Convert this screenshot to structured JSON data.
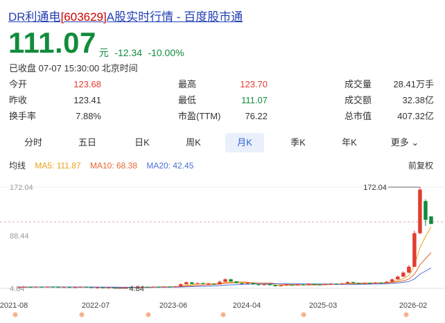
{
  "header": {
    "title_prefix": "DR利通电",
    "code": "[603629]",
    "title_suffix": "A股实时行情 - 百度股市通"
  },
  "quote": {
    "price": "111.07",
    "unit": "元",
    "change": "-12.34",
    "change_pct": "-10.00%",
    "status": "已收盘 07-07 15:30:00 北京时间"
  },
  "stats": {
    "open_label": "今开",
    "open": "123.68",
    "prev_close_label": "昨收",
    "prev_close": "123.41",
    "turnover_label": "换手率",
    "turnover": "7.88%",
    "high_label": "最高",
    "high": "123.70",
    "low_label": "最低",
    "low": "111.07",
    "pe_label": "市盈(TTM)",
    "pe": "76.22",
    "volume_label": "成交量",
    "volume": "28.41万手",
    "amount_label": "成交额",
    "amount": "32.38亿",
    "mktcap_label": "总市值",
    "mktcap": "407.32亿"
  },
  "tabs": [
    "分时",
    "五日",
    "日K",
    "周K",
    "月K",
    "季K",
    "年K",
    "更多"
  ],
  "active_tab": "月K",
  "legend": {
    "title": "均线",
    "ma5": "MA5: 111.87",
    "ma10": "MA10: 68.38",
    "ma20": "MA20: 42.45",
    "fuquan": "前复权"
  },
  "colors": {
    "up": "#e33b30",
    "down": "#118c3c",
    "ma5": "#e8a21b",
    "ma10": "#e8652f",
    "ma20": "#4a6fd8",
    "accent": "#2a5fd6"
  },
  "chart_data": {
    "type": "candlestick",
    "y_ticks": [
      "172.04",
      "88.44",
      "4.84"
    ],
    "ylim": [
      4.84,
      172.04
    ],
    "x_ticks": [
      "2021-08",
      "2022-07",
      "2023-06",
      "2024-04",
      "2025-03",
      "2026-02"
    ],
    "high_marker": "172.04",
    "low_marker": "4.84",
    "candles": [
      {
        "o": 6.6,
        "c": 6.9,
        "h": 7.2,
        "l": 6.3
      },
      {
        "o": 6.9,
        "c": 7.3,
        "h": 7.7,
        "l": 6.7
      },
      {
        "o": 7.3,
        "c": 6.9,
        "h": 7.5,
        "l": 6.6
      },
      {
        "o": 6.9,
        "c": 7.4,
        "h": 7.8,
        "l": 6.7
      },
      {
        "o": 7.4,
        "c": 7.1,
        "h": 7.7,
        "l": 6.9
      },
      {
        "o": 7.1,
        "c": 7.5,
        "h": 7.9,
        "l": 6.9
      },
      {
        "o": 7.5,
        "c": 7.2,
        "h": 7.8,
        "l": 7.0
      },
      {
        "o": 7.2,
        "c": 6.8,
        "h": 7.4,
        "l": 6.5
      },
      {
        "o": 6.8,
        "c": 7.1,
        "h": 7.4,
        "l": 6.6
      },
      {
        "o": 7.1,
        "c": 6.7,
        "h": 7.3,
        "l": 6.4
      },
      {
        "o": 6.7,
        "c": 6.9,
        "h": 7.2,
        "l": 6.5
      },
      {
        "o": 6.9,
        "c": 7.3,
        "h": 7.6,
        "l": 6.7
      },
      {
        "o": 7.3,
        "c": 6.8,
        "h": 7.5,
        "l": 6.6
      },
      {
        "o": 6.8,
        "c": 5.9,
        "h": 7.0,
        "l": 5.6
      },
      {
        "o": 5.9,
        "c": 6.3,
        "h": 6.6,
        "l": 5.7
      },
      {
        "o": 6.3,
        "c": 5.6,
        "h": 6.5,
        "l": 5.3
      },
      {
        "o": 5.6,
        "c": 6.2,
        "h": 6.5,
        "l": 5.4
      },
      {
        "o": 6.2,
        "c": 5.5,
        "h": 6.4,
        "l": 4.84
      },
      {
        "o": 5.5,
        "c": 6.1,
        "h": 6.4,
        "l": 5.3
      },
      {
        "o": 6.1,
        "c": 6.6,
        "h": 7.0,
        "l": 5.9
      },
      {
        "o": 6.6,
        "c": 6.3,
        "h": 6.9,
        "l": 6.1
      },
      {
        "o": 6.3,
        "c": 6.8,
        "h": 7.1,
        "l": 6.1
      },
      {
        "o": 6.8,
        "c": 7.3,
        "h": 7.7,
        "l": 6.6
      },
      {
        "o": 7.3,
        "c": 7.0,
        "h": 7.6,
        "l": 6.8
      },
      {
        "o": 7.0,
        "c": 7.6,
        "h": 8.0,
        "l": 6.8
      },
      {
        "o": 7.6,
        "c": 7.2,
        "h": 7.9,
        "l": 7.0
      },
      {
        "o": 7.2,
        "c": 7.8,
        "h": 8.2,
        "l": 7.0
      },
      {
        "o": 7.8,
        "c": 7.4,
        "h": 8.0,
        "l": 7.2
      },
      {
        "o": 7.4,
        "c": 8.2,
        "h": 8.6,
        "l": 7.2
      },
      {
        "o": 8.2,
        "c": 11.6,
        "h": 13.2,
        "l": 8.0
      },
      {
        "o": 11.6,
        "c": 14.8,
        "h": 16.4,
        "l": 11.2
      },
      {
        "o": 14.8,
        "c": 12.1,
        "h": 15.4,
        "l": 11.6
      },
      {
        "o": 12.1,
        "c": 13.4,
        "h": 14.6,
        "l": 11.8
      },
      {
        "o": 13.4,
        "c": 11.9,
        "h": 13.9,
        "l": 11.4
      },
      {
        "o": 11.9,
        "c": 12.6,
        "h": 13.4,
        "l": 11.5
      },
      {
        "o": 12.6,
        "c": 11.4,
        "h": 13.0,
        "l": 11.0
      },
      {
        "o": 11.4,
        "c": 15.6,
        "h": 17.8,
        "l": 11.2
      },
      {
        "o": 15.6,
        "c": 19.8,
        "h": 21.4,
        "l": 15.1
      },
      {
        "o": 19.8,
        "c": 16.2,
        "h": 20.6,
        "l": 15.6
      },
      {
        "o": 16.2,
        "c": 13.6,
        "h": 16.8,
        "l": 13.0
      },
      {
        "o": 13.6,
        "c": 12.4,
        "h": 14.2,
        "l": 11.8
      },
      {
        "o": 12.4,
        "c": 13.8,
        "h": 14.8,
        "l": 12.0
      },
      {
        "o": 13.8,
        "c": 11.6,
        "h": 14.2,
        "l": 11.0
      },
      {
        "o": 11.6,
        "c": 10.2,
        "h": 12.0,
        "l": 9.6
      },
      {
        "o": 10.2,
        "c": 11.4,
        "h": 12.2,
        "l": 9.8
      },
      {
        "o": 11.4,
        "c": 10.3,
        "h": 11.8,
        "l": 9.6
      },
      {
        "o": 10.3,
        "c": 8.4,
        "h": 10.6,
        "l": 7.8
      },
      {
        "o": 8.4,
        "c": 9.6,
        "h": 10.2,
        "l": 8.0
      },
      {
        "o": 9.6,
        "c": 10.8,
        "h": 11.6,
        "l": 9.2
      },
      {
        "o": 10.8,
        "c": 10.1,
        "h": 11.2,
        "l": 9.6
      },
      {
        "o": 10.1,
        "c": 11.2,
        "h": 12.0,
        "l": 9.8
      },
      {
        "o": 11.2,
        "c": 10.4,
        "h": 11.8,
        "l": 10.0
      },
      {
        "o": 10.4,
        "c": 12.2,
        "h": 13.0,
        "l": 10.2
      },
      {
        "o": 12.2,
        "c": 11.3,
        "h": 12.8,
        "l": 10.9
      },
      {
        "o": 11.3,
        "c": 10.7,
        "h": 11.8,
        "l": 10.2
      },
      {
        "o": 10.7,
        "c": 12.0,
        "h": 12.6,
        "l": 10.4
      },
      {
        "o": 12.0,
        "c": 12.6,
        "h": 13.4,
        "l": 11.6
      },
      {
        "o": 12.6,
        "c": 11.8,
        "h": 13.0,
        "l": 11.3
      },
      {
        "o": 11.8,
        "c": 13.0,
        "h": 13.8,
        "l": 11.5
      },
      {
        "o": 13.0,
        "c": 15.2,
        "h": 16.4,
        "l": 12.8
      },
      {
        "o": 15.2,
        "c": 13.8,
        "h": 15.8,
        "l": 13.2
      },
      {
        "o": 13.8,
        "c": 13.0,
        "h": 14.4,
        "l": 12.6
      },
      {
        "o": 13.0,
        "c": 13.9,
        "h": 14.6,
        "l": 12.7
      },
      {
        "o": 13.9,
        "c": 13.2,
        "h": 14.4,
        "l": 12.8
      },
      {
        "o": 13.2,
        "c": 14.4,
        "h": 15.2,
        "l": 12.9
      },
      {
        "o": 14.4,
        "c": 13.9,
        "h": 15.0,
        "l": 13.4
      },
      {
        "o": 13.9,
        "c": 15.8,
        "h": 16.8,
        "l": 13.6
      },
      {
        "o": 15.8,
        "c": 19.6,
        "h": 21.2,
        "l": 15.4
      },
      {
        "o": 19.6,
        "c": 24.2,
        "h": 26.0,
        "l": 19.0
      },
      {
        "o": 24.2,
        "c": 30.8,
        "h": 33.0,
        "l": 23.6
      },
      {
        "o": 30.8,
        "c": 40.6,
        "h": 43.2,
        "l": 30.2
      },
      {
        "o": 40.6,
        "c": 96.0,
        "h": 100.0,
        "l": 40.0
      },
      {
        "o": 96.0,
        "c": 168.0,
        "h": 172.04,
        "l": 94.0
      },
      {
        "o": 149.0,
        "c": 118.0,
        "h": 152.0,
        "l": 108.0
      },
      {
        "o": 123.68,
        "c": 111.07,
        "h": 123.7,
        "l": 111.07
      }
    ]
  }
}
